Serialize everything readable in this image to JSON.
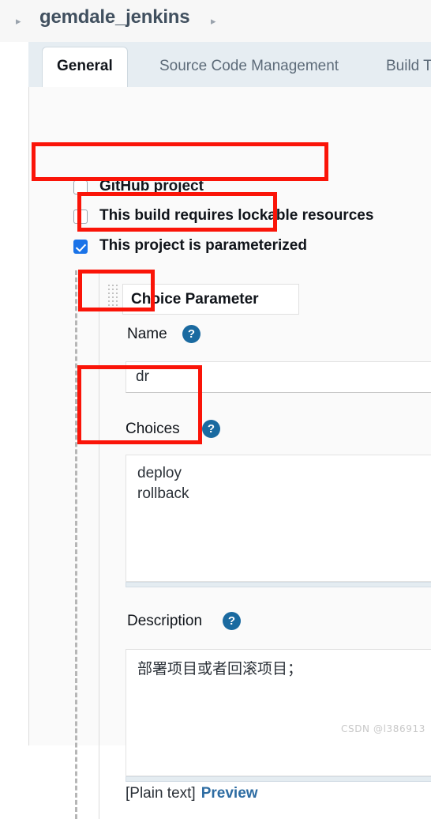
{
  "breadcrumb": {
    "arrow_left": "▸",
    "arrow_right": "▸",
    "title": "gemdale_jenkins"
  },
  "tabs": [
    {
      "label": "General",
      "active": true
    },
    {
      "label": "Source Code Management",
      "active": false
    },
    {
      "label": "Build T",
      "active": false
    }
  ],
  "checkboxes": [
    {
      "label": "GitHub project",
      "checked": false
    },
    {
      "label": "This build requires lockable resources",
      "checked": false
    },
    {
      "label": "This project is parameterized",
      "checked": true
    }
  ],
  "parameter": {
    "type_label": "Choice Parameter",
    "name": {
      "label": "Name",
      "help": "?",
      "value": "dr"
    },
    "choices": {
      "label": "Choices",
      "help": "?",
      "value": "deploy\nrollback"
    },
    "description": {
      "label": "Description",
      "help": "?",
      "value": "部署项目或者回滚项目；",
      "plain_text_label": "[Plain text]",
      "preview_label": "Preview"
    }
  },
  "colors": {
    "annotation_red": "#fa1408",
    "checkbox_blue": "#1a73e8",
    "help_blue": "#1a6aa0",
    "link_blue": "#2d6ca2",
    "tab_strip_bg": "#e6edf2"
  },
  "watermark": "CSDN @l386913"
}
